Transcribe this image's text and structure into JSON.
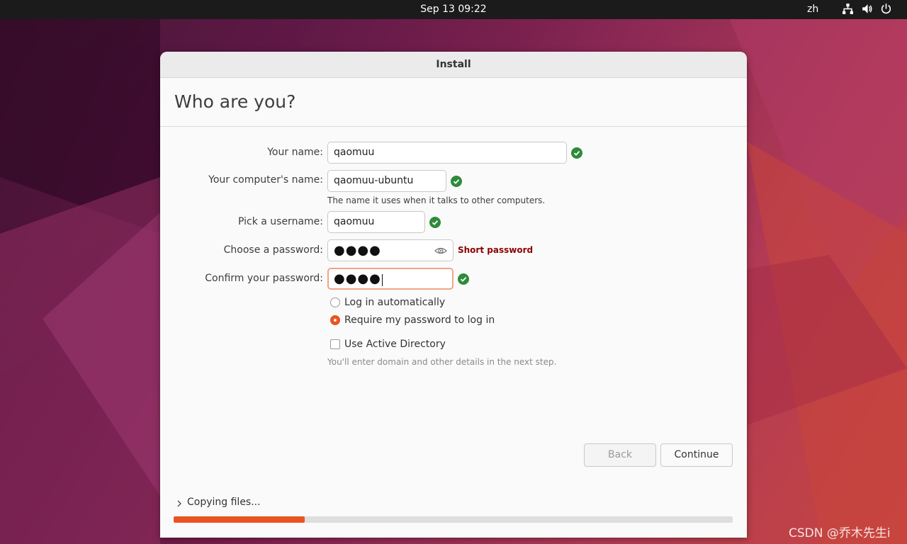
{
  "topbar": {
    "clock": "Sep 13  09:22",
    "language": "zh"
  },
  "window": {
    "title": "Install",
    "heading": "Who are you?"
  },
  "form": {
    "name_label": "Your name:",
    "name_value": "qaomuu",
    "computer_label": "Your computer's name:",
    "computer_value": "qaomuu-ubuntu",
    "computer_hint": "The name it uses when it talks to other computers.",
    "username_label": "Pick a username:",
    "username_value": "qaomuu",
    "password_label": "Choose a password:",
    "password_value": "●●●●",
    "password_warning": "Short password",
    "confirm_label": "Confirm your password:",
    "confirm_value": "●●●●",
    "login_auto_label": "Log in automatically",
    "login_require_label": "Require my password to log in",
    "active_directory_label": "Use Active Directory",
    "active_directory_hint": "You'll enter domain and other details in the next step."
  },
  "buttons": {
    "back_label": "Back",
    "continue_label": "Continue"
  },
  "progress": {
    "label": "Copying files...",
    "fraction": 0.235
  },
  "watermark": "CSDN @乔木先生i",
  "colors": {
    "accent": "#e95420",
    "ok": "#2e8b3a",
    "warning": "#8b0000"
  },
  "icons": {
    "network": "network-icon",
    "volume": "volume-icon",
    "power": "power-icon",
    "valid": "check-circle-icon",
    "show_password": "eye-icon",
    "expand": "chevron-right-icon"
  }
}
